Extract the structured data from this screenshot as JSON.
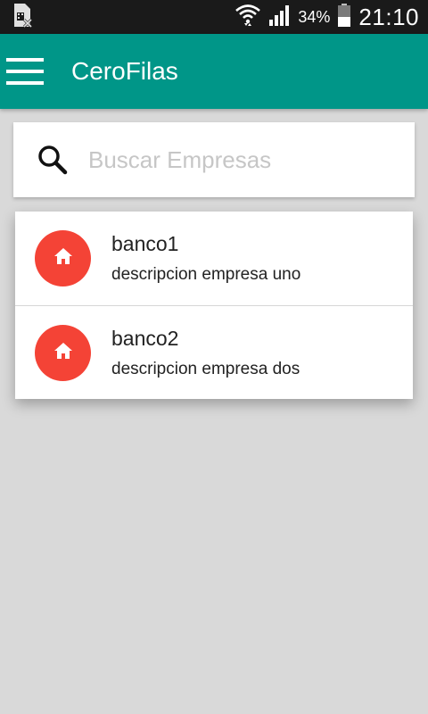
{
  "status_bar": {
    "battery_percent": "34%",
    "time": "21:10",
    "icons": [
      "sim-card-icon",
      "wifi-icon",
      "signal-icon",
      "battery-icon"
    ]
  },
  "app_bar": {
    "title": "CeroFilas",
    "color": "#009688",
    "menu_icon": "hamburger-menu-icon"
  },
  "search": {
    "placeholder": "Buscar Empresas",
    "value": "",
    "icon": "search-icon"
  },
  "companies": {
    "avatar_color": "#f44336",
    "avatar_icon": "home-icon",
    "items": [
      {
        "name": "banco1",
        "description": "descripcion empresa uno"
      },
      {
        "name": "banco2",
        "description": "descripcion empresa dos"
      }
    ]
  }
}
